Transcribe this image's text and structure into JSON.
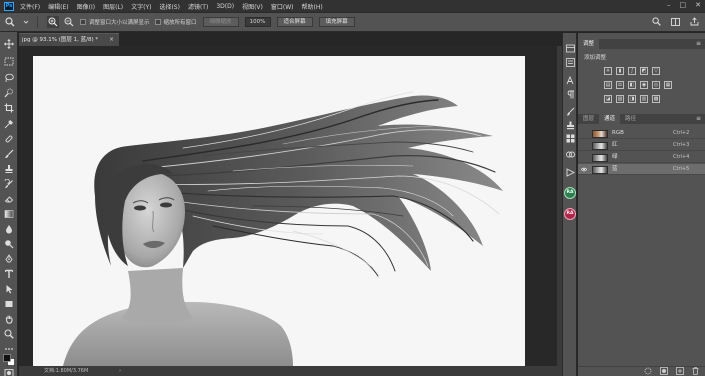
{
  "app": {
    "logo": "Ps",
    "menu": [
      "文件(F)",
      "编辑(E)",
      "图像(I)",
      "图层(L)",
      "文字(Y)",
      "选择(S)",
      "滤镜(T)",
      "3D(D)",
      "视图(V)",
      "窗口(W)",
      "帮助(H)"
    ],
    "window_controls": [
      "–",
      "□",
      "✕"
    ]
  },
  "options_bar": {
    "tool_icon": "zoom-icon",
    "checkbox_resize": "调整窗口大小以满屏显示",
    "checkbox_all_windows": "缩放所有窗口",
    "scrubby_zoom": "细微缩放",
    "zoom_value": "100%",
    "fit_screen": "适合屏幕",
    "fill_screen": "填充屏幕"
  },
  "document": {
    "tab_title": "jpg @ 93.1% (图层 1, 蓝/8) *",
    "close": "×",
    "status": "文档:1.80M/3.76M",
    "status_arrow": "›"
  },
  "panels": {
    "top_tabs": [
      "调整"
    ],
    "adjustments_title": "添加调整",
    "bottom_tabs": [
      "图层",
      "通道",
      "路径"
    ],
    "active_bottom_tab": "通道",
    "channels": [
      {
        "name": "RGB",
        "shortcut": "Ctrl+2",
        "visible": false,
        "color": true
      },
      {
        "name": "红",
        "shortcut": "Ctrl+3",
        "visible": false,
        "color": false
      },
      {
        "name": "绿",
        "shortcut": "Ctrl+4",
        "visible": false,
        "color": false
      },
      {
        "name": "蓝",
        "shortcut": "Ctrl+5",
        "visible": true,
        "color": false,
        "selected": true
      }
    ],
    "menu_icon": "≡"
  },
  "dock": {
    "ra_green": "RA",
    "ra_red": "RA"
  },
  "colors": {
    "accent_blue": "#31a8ff",
    "ra_green": "#2e7d4f",
    "ra_red": "#b0254a"
  }
}
